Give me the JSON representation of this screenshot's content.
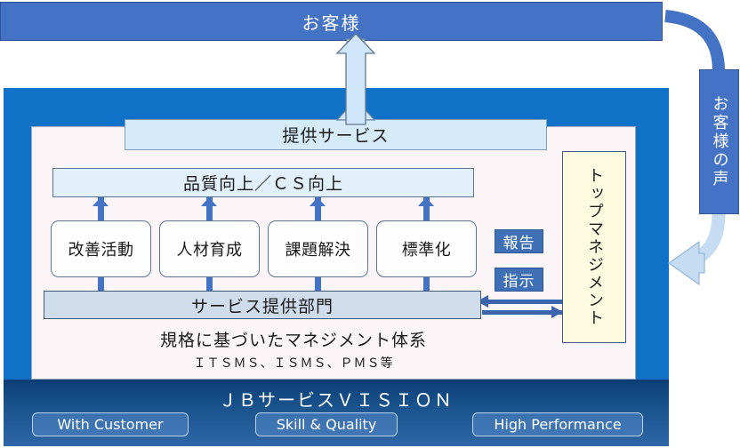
{
  "diagram": {
    "top_bar": {
      "label": "お客様"
    },
    "customer_voice": {
      "label": "お客様の声"
    },
    "service_box": {
      "label": "提供サービス"
    },
    "quality_box": {
      "label": "品質向上／ＣＳ向上"
    },
    "activities": [
      {
        "label": "改善活動"
      },
      {
        "label": "人材育成"
      },
      {
        "label": "課題解決"
      },
      {
        "label": "標準化"
      }
    ],
    "department_box": {
      "label": "サービス提供部門"
    },
    "badges": {
      "report": "報告",
      "instruction": "指示"
    },
    "top_management": {
      "label": "トップマネジメント"
    },
    "management_system": {
      "title": "規格に基づいたマネジメント体系",
      "subtitle": "ＩＴＳＭＳ、ＩＳＭＳ、ＰＭＳ等"
    },
    "vision": {
      "title": "ＪＢサービスＶＩＳＩＯＮ",
      "buttons": [
        {
          "label": "With Customer"
        },
        {
          "label": "Skill & Quality"
        },
        {
          "label": "High Performance"
        }
      ]
    },
    "colors": {
      "top_bar_blue": "#4472C4",
      "panel_blue": "#0F72C6",
      "inner_panel": "#FBF5F8",
      "service_box": "#D6EBF9",
      "quality_box": "#E2F0FB",
      "department_box": "#CFDCEC",
      "top_management_box": "#FCFBE0",
      "badge_blue": "#3F6FB5",
      "arrow_blue": "#3A65AD",
      "light_arrow": "#C5DCF2",
      "vision_bar_top": "#0C3E75",
      "vision_bar_bottom": "#2E66A8"
    }
  }
}
